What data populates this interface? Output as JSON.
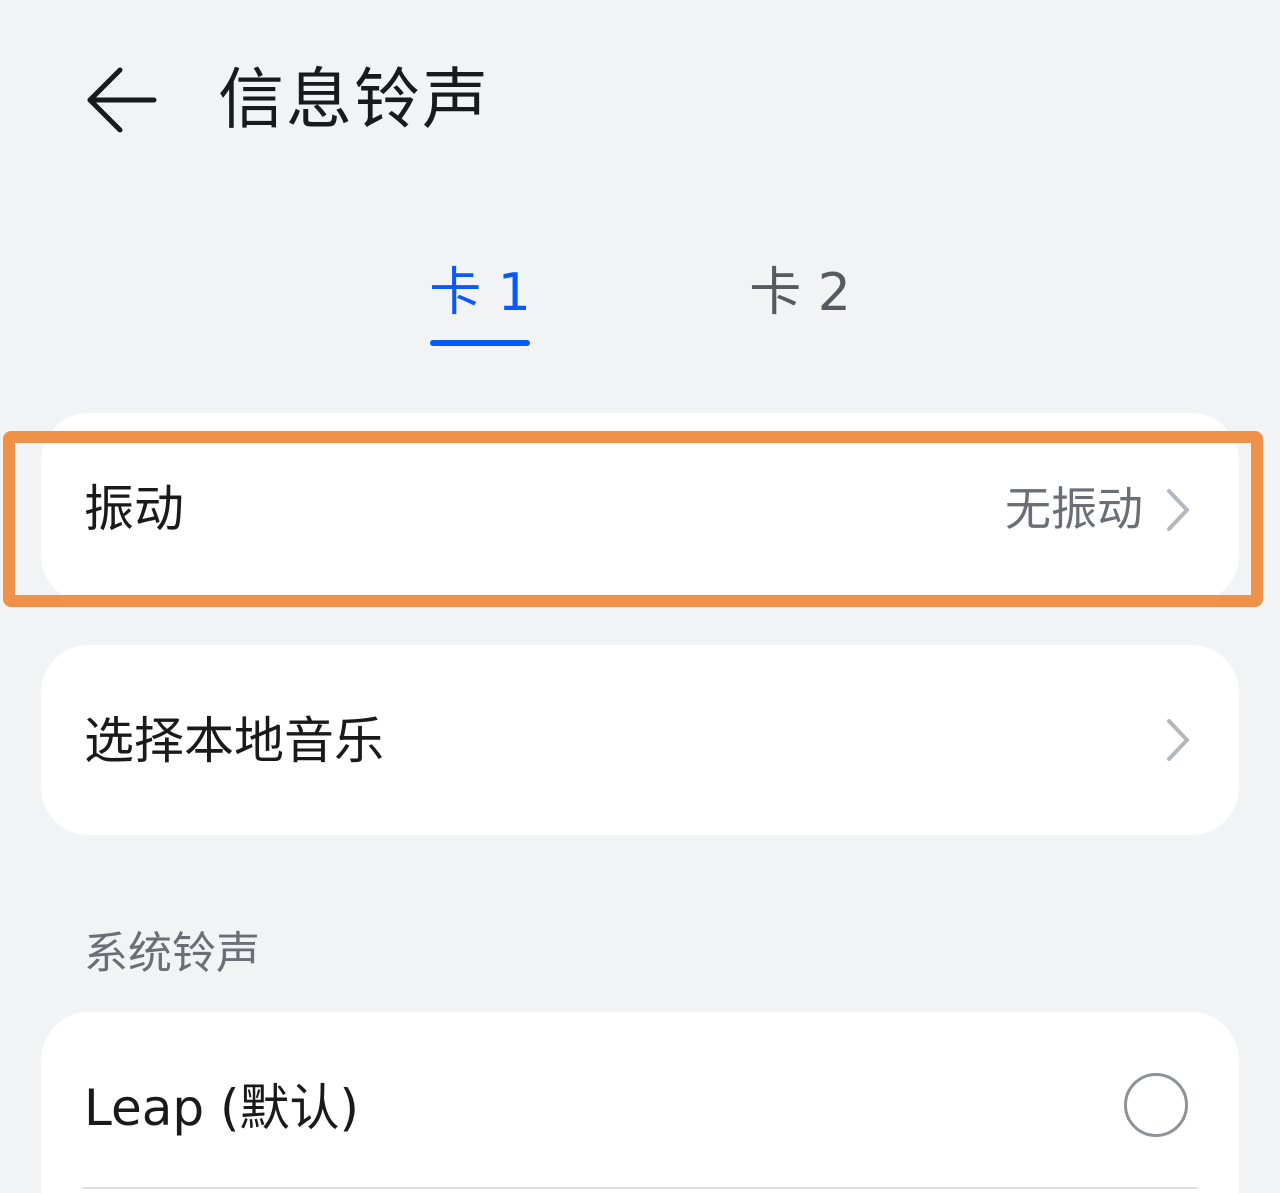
{
  "header": {
    "title": "信息铃声",
    "back_icon": "arrow-left-icon"
  },
  "tabs": [
    {
      "label": "卡 1",
      "active": true,
      "color": "#0a59f7"
    },
    {
      "label": "卡 2",
      "active": false,
      "color": "#555a60"
    }
  ],
  "vibration": {
    "label": "振动",
    "value": "无振动",
    "chevron_icon": "chevron-right-icon"
  },
  "local_music": {
    "label": "选择本地音乐",
    "chevron_icon": "chevron-right-icon"
  },
  "system_ringtones": {
    "section_title": "系统铃声",
    "items": [
      {
        "label": "Leap (默认)",
        "selected": false
      }
    ]
  },
  "colors": {
    "background": "#f1f3f5",
    "card": "#ffffff",
    "accent": "#0a59f7",
    "highlight": "#f0914a"
  }
}
